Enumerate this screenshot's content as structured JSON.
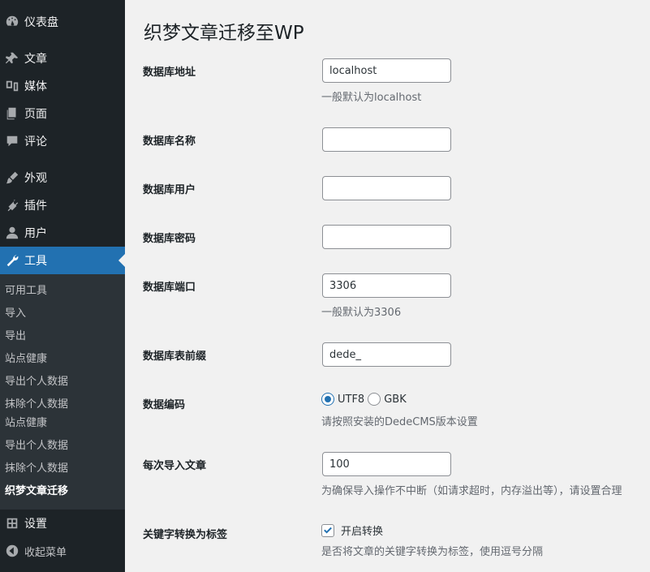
{
  "sidebar": {
    "items": [
      {
        "label": "仪表盘",
        "icon": "dashboard-icon"
      },
      {
        "label": "文章",
        "icon": "pin-icon"
      },
      {
        "label": "媒体",
        "icon": "media-icon"
      },
      {
        "label": "页面",
        "icon": "page-icon"
      },
      {
        "label": "评论",
        "icon": "comment-icon"
      },
      {
        "label": "外观",
        "icon": "brush-icon"
      },
      {
        "label": "插件",
        "icon": "plugin-icon"
      },
      {
        "label": "用户",
        "icon": "user-icon"
      },
      {
        "label": "工具",
        "icon": "wrench-icon"
      },
      {
        "label": "设置",
        "icon": "settings-icon"
      },
      {
        "label": "收起菜单",
        "icon": "collapse-icon"
      }
    ],
    "submenu": [
      {
        "label": "可用工具"
      },
      {
        "label": "导入"
      },
      {
        "label": "导出"
      },
      {
        "label": "站点健康"
      },
      {
        "label": "导出个人数据"
      },
      {
        "label": "抹除个人数据"
      },
      {
        "label": "站点健康"
      },
      {
        "label": "导出个人数据"
      },
      {
        "label": "抹除个人数据"
      },
      {
        "label": "织梦文章迁移"
      }
    ]
  },
  "main": {
    "title": "织梦文章迁移至WP",
    "fields": {
      "db_host": {
        "label": "数据库地址",
        "value": "localhost",
        "desc": "一般默认为localhost"
      },
      "db_name": {
        "label": "数据库名称",
        "value": ""
      },
      "db_user": {
        "label": "数据库用户",
        "value": ""
      },
      "db_pass": {
        "label": "数据库密码",
        "value": ""
      },
      "db_port": {
        "label": "数据库端口",
        "value": "3306",
        "desc": "一般默认为3306"
      },
      "db_prefix": {
        "label": "数据库表前缀",
        "value": "dede_"
      },
      "charset": {
        "label": "数据编码",
        "option1": "UTF8",
        "option2": "GBK",
        "selected": "UTF8",
        "desc": "请按照安装的DedeCMS版本设置"
      },
      "batch": {
        "label": "每次导入文章",
        "value": "100",
        "desc": "为确保导入操作不中断（如请求超时，内存溢出等），请设置合理"
      },
      "keywords": {
        "label": "关键字转换为标签",
        "checkbox_label": "开启转换",
        "checked": true,
        "desc": "是否将文章的关键字转换为标签，使用逗号分隔"
      }
    }
  },
  "colors": {
    "accent": "#2271b1",
    "sidebar_bg": "#1d2327",
    "submenu_bg": "#2c3338",
    "page_bg": "#f1f1f1"
  }
}
